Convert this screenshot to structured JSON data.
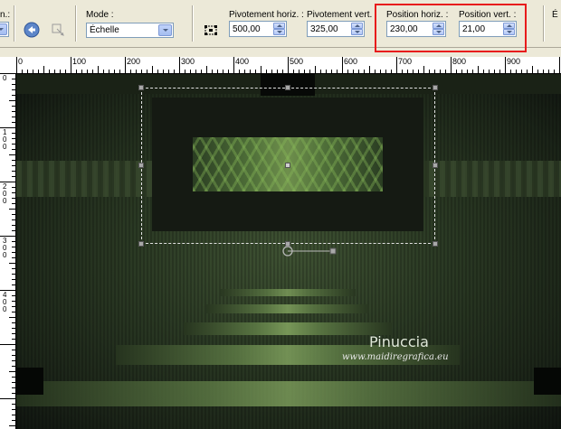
{
  "toolbar": {
    "cut_label": "n.:",
    "mode_label": "Mode :",
    "mode_value": "Échelle",
    "pivot_h_label": "Pivotement horiz. :",
    "pivot_h_value": "500,00",
    "pivot_v_label": "Pivotement vert. :",
    "pivot_v_value": "325,00",
    "pos_h_label": "Position horiz. :",
    "pos_h_value": "230,00",
    "pos_v_label": "Position vert. :",
    "pos_v_value": "21,00",
    "edge_label": "É",
    "icons": [
      "reset-icon",
      "merge-icon",
      "handles-icon"
    ]
  },
  "ruler": {
    "top_labels": [
      "0",
      "100",
      "200",
      "300",
      "400",
      "500",
      "600",
      "700",
      "800",
      "900"
    ],
    "left_labels": [
      "0",
      "1 0 0",
      "2 0 0",
      "3 0 0",
      "4 0 0"
    ]
  },
  "watermark": {
    "name": "Pinuccia",
    "url": "www.maidiregrafica.eu"
  },
  "colors": {
    "highlight": "#e81c1c",
    "canvas_dark": "#151a13",
    "canvas_green": "#5d7a45"
  }
}
